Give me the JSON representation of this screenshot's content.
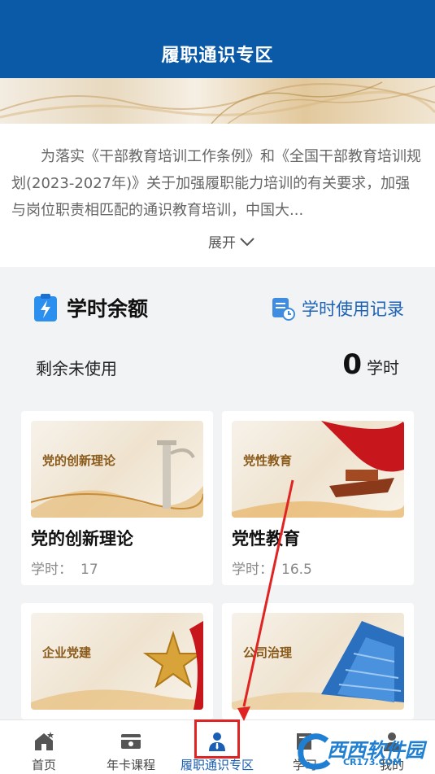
{
  "header": {
    "title": "履职通识专区"
  },
  "intro": {
    "text": "为落实《干部教育培训工作条例》和《全国干部教育培训规划(2023-2027年)》关于加强履职能力培训的有关要求，加强与岗位职责相匹配的通识教育培训，中国大...",
    "expand_label": "展开"
  },
  "hours": {
    "title": "学时余额",
    "record_link": "学时使用记录",
    "remaining_label": "剩余未使用",
    "remaining_value": "0",
    "remaining_unit": "学时"
  },
  "courses": [
    {
      "image_label": "党的创新理论",
      "title": "党的创新理论",
      "hours_label": "学时：",
      "hours_value": "17"
    },
    {
      "image_label": "党性教育",
      "title": "党性教育",
      "hours_label": "学时：",
      "hours_value": "16.5"
    },
    {
      "image_label": "企业党建"
    },
    {
      "image_label": "公司治理"
    }
  ],
  "tabbar": {
    "items": [
      {
        "label": "首页",
        "icon": "home-icon"
      },
      {
        "label": "年卡课程",
        "icon": "card-icon"
      },
      {
        "label": "履职通识专区",
        "icon": "person-icon",
        "active": true
      },
      {
        "label": "学习",
        "icon": "book-icon"
      },
      {
        "label": "我的",
        "icon": "user-icon"
      }
    ]
  },
  "watermark": {
    "text": "西西软件园",
    "sub": "CR173.COM"
  },
  "colors": {
    "primary": "#0a5aa8",
    "link": "#1c62b6",
    "annotation": "#e02424"
  }
}
